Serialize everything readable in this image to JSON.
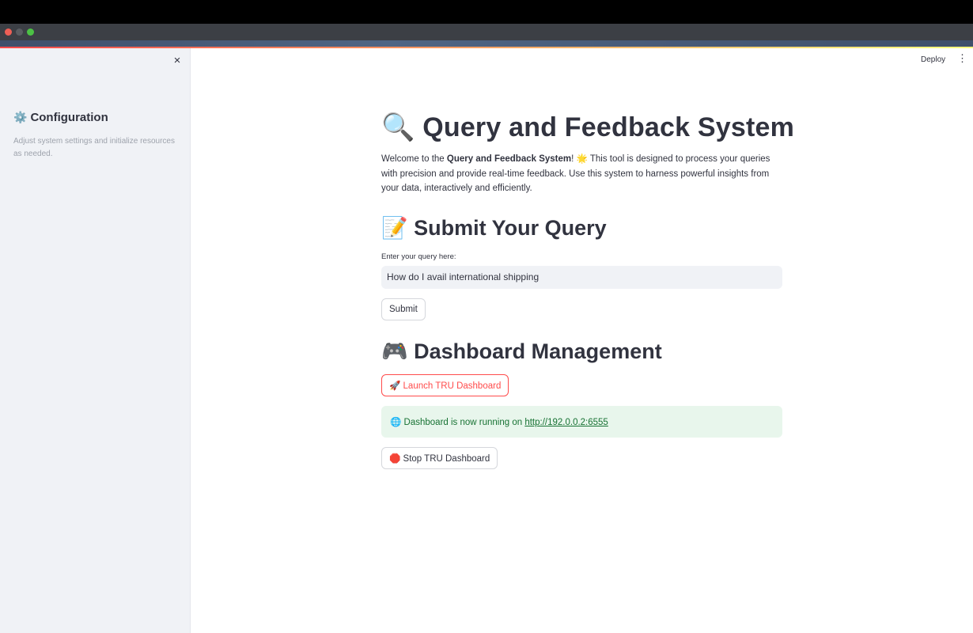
{
  "header": {
    "deploy_label": "Deploy",
    "menu_icon": "⋮",
    "close_icon": "×"
  },
  "sidebar": {
    "gear_icon": "⚙️",
    "title": "Configuration",
    "caption": "Adjust system settings and initialize resources as needed."
  },
  "main": {
    "title_icon": "🔍",
    "title": "Query and Feedback System",
    "intro": {
      "prefix": "Welcome to the ",
      "bold": "Query and Feedback System",
      "exclaim": "!",
      "star_icon": "🌟",
      "rest": " This tool is designed to process your queries with precision and provide real-time feedback. Use this system to harness powerful insights from your data, interactively and efficiently."
    },
    "query_section": {
      "icon": "📝",
      "heading": "Submit Your Query",
      "input_label": "Enter your query here:",
      "input_value": "How do I avail international shipping",
      "submit_label": "Submit"
    },
    "dashboard_section": {
      "icon": "🎮",
      "heading": "Dashboard Management",
      "launch_icon": "🚀",
      "launch_label": "Launch TRU Dashboard",
      "status_icon": "🌐",
      "status_text": "Dashboard is now running on ",
      "status_link": "http://192.0.0.2:6555",
      "stop_icon": "🛑",
      "stop_label": "Stop TRU Dashboard"
    }
  },
  "colors": {
    "accent": "#ff4b4b",
    "sidebar_bg": "#f0f2f6",
    "success_bg": "#e8f6ec",
    "success_text": "#177233"
  }
}
